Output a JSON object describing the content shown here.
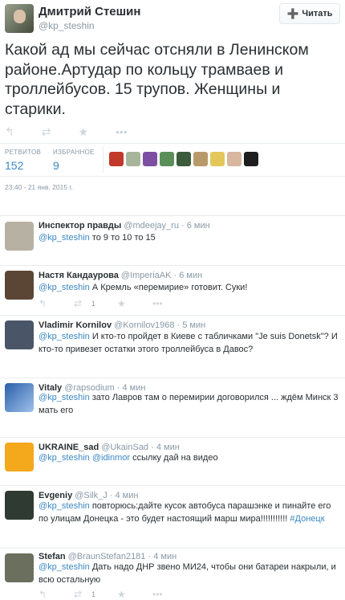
{
  "main_tweet": {
    "author_name": "Дмитрий Стешин",
    "author_handle": "@kp_steshin",
    "follow_label": "Читать",
    "text": "Какой ад мы сейчас отсняли в Ленинском районе.Артудар  по кольцу трамваев и троллейбусов. 15 трупов. Женщины и старики.",
    "retweets_label": "РЕТВИТОВ",
    "retweets_count": "152",
    "favorites_label": "ИЗБРАННОЕ",
    "favorites_count": "9",
    "timestamp": "23:40 - 21 янв. 2015 г."
  },
  "icons": {
    "reply": "reply-icon",
    "retweet": "retweet-icon",
    "favorite": "star-icon",
    "more": "more-icon",
    "follow": "follow-person-icon"
  },
  "colors": {
    "link": "#3b88c3",
    "muted": "#8899a6",
    "icon_idle": "#ccd6dd",
    "text": "#292f33"
  },
  "replies": [
    {
      "name": "Инспектор правды",
      "handle": "@mdeejay_ru",
      "time": "· 6 мин",
      "mention": "@kp_steshin",
      "mention2": "",
      "text": " то 9 то 10 то 15",
      "rt_count": ""
    },
    {
      "name": "Настя Кандаурова",
      "handle": "@ImperiaAK",
      "time": "· 6 мин",
      "mention": "@kp_steshin",
      "mention2": "",
      "text": " А Кремль «перемирие» готовит. Суки!",
      "rt_count": "1"
    },
    {
      "name": "Vladimir Kornilov",
      "handle": "@Kornilov1968",
      "time": "· 5 мин",
      "mention": "@kp_steshin",
      "mention2": "",
      "text": " И кто-то пройдет в Киеве с табличками \"Je suis Donetsk\"? И кто-то привезет остатки этого троллейбуса в Давос?",
      "rt_count": ""
    },
    {
      "name": "Vitaly",
      "handle": "@rapsodium",
      "time": "· 4 мин",
      "mention": "@kp_steshin",
      "mention2": "",
      "text": " зато Лавров там о перемирии договорился ... ждём Минск 3 мать его",
      "rt_count": ""
    },
    {
      "name": "UKRAINE_sad",
      "handle": "@UkainSad",
      "time": "· 4 мин",
      "mention": "@kp_steshin",
      "mention2": "@idinmor",
      "text": " ссылку дай на видео",
      "rt_count": ""
    },
    {
      "name": "Evgeniy",
      "handle": "@Silk_J",
      "time": "· 4 мин",
      "mention": "@kp_steshin",
      "mention2": "",
      "text": " повторюсь:дайте кусок автобуса парашэнке и пинайте его по  улицам Донецка - это будет настоящий марш мира!!!!!!!!!!! ",
      "hashtag": "#Донецк",
      "rt_count": ""
    },
    {
      "name": "Stefan",
      "handle": "@BraunStefan2181",
      "time": "· 4 мин",
      "mention": "@kp_steshin",
      "mention2": "",
      "text": " Дать надо ДНР звено МИ24, чтобы они батареи накрыли, и всю остальную",
      "rt_count": "1"
    }
  ]
}
